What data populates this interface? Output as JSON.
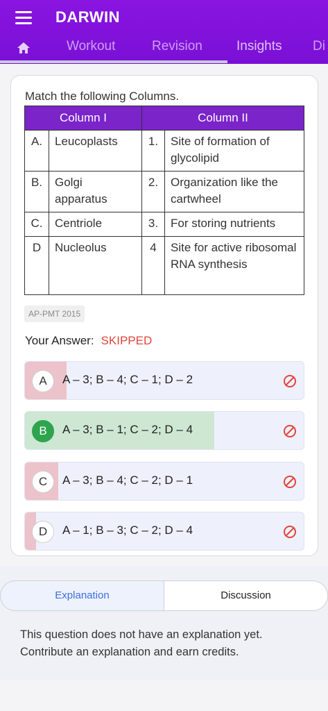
{
  "header": {
    "title": "DARWIN",
    "tabs": [
      {
        "label": "Workout"
      },
      {
        "label": "Revision"
      },
      {
        "label": "Insights"
      },
      {
        "label": "Di"
      }
    ]
  },
  "question": {
    "prompt": "Match the following Columns.",
    "table": {
      "headers": [
        "Column I",
        "Column II"
      ],
      "rows": [
        {
          "letter": "A.",
          "item": "Leucoplasts",
          "num": "1.",
          "match": "Site of formation of glycolipid"
        },
        {
          "letter": "B.",
          "item": "Golgi apparatus",
          "num": "2.",
          "match": "Organization like the cartwheel"
        },
        {
          "letter": "C.",
          "item": "Centriole",
          "num": "3.",
          "match": "For storing nutrients"
        },
        {
          "letter": "D",
          "item": "Nucleolus",
          "num": "4",
          "match": "Site for active ribosomal RNA synthesis"
        }
      ]
    },
    "source_tag": "AP-PMT 2015",
    "your_answer_label": "Your Answer:",
    "your_answer_value": "SKIPPED",
    "options": [
      {
        "key": "A",
        "text": "A – 3; B – 4; C – 1; D – 2",
        "response_fraction": 0.15,
        "correct": false
      },
      {
        "key": "B",
        "text": "A – 3; B – 1; C – 2; D – 4",
        "response_fraction": 0.68,
        "correct": true
      },
      {
        "key": "C",
        "text": "A – 3; B – 4; C – 2; D – 1",
        "response_fraction": 0.12,
        "correct": false
      },
      {
        "key": "D",
        "text": "A – 1; B – 3; C – 2; D – 4",
        "response_fraction": 0.04,
        "correct": false
      }
    ]
  },
  "bottom": {
    "explanation_tab": "Explanation",
    "discussion_tab": "Discussion",
    "explanation_text": "This question does not have an explanation yet. Contribute an explanation and earn credits."
  },
  "colors": {
    "brand": "#7a10d6",
    "wrong_fill": "#ecc2cb",
    "correct_fill": "#cde7d3",
    "correct_badge": "#2ea44f",
    "skipped": "#e0453c"
  }
}
